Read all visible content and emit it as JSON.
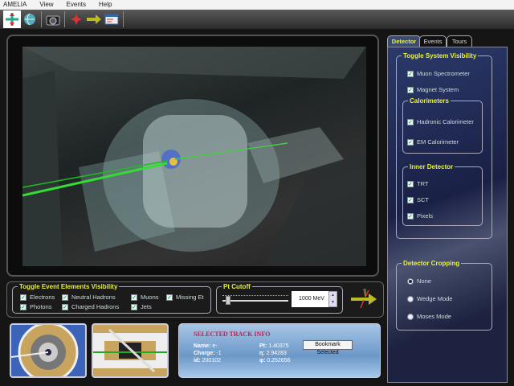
{
  "menu": [
    "AMELIA",
    "View",
    "Events",
    "Help"
  ],
  "toolbar": {
    "icons": [
      "move-icon",
      "globe-icon",
      "camera-icon",
      "star-burst-icon",
      "arrow-icon",
      "window-icon"
    ]
  },
  "events_panel": {
    "title": "Toggle Event Elements Visibility",
    "items": [
      {
        "label": "Electrons",
        "checked": true
      },
      {
        "label": "Neutral Hadrons",
        "checked": true
      },
      {
        "label": "Muons",
        "checked": true
      },
      {
        "label": "Missing Et",
        "checked": true
      },
      {
        "label": "Photons",
        "checked": true
      },
      {
        "label": "Charged Hadrons",
        "checked": true
      },
      {
        "label": "Jets",
        "checked": true
      }
    ]
  },
  "pt_cutoff": {
    "title": "Pt Cutoff",
    "value": "1000 MeV",
    "slider_fraction": 0.05
  },
  "track_info": {
    "title": "SELECTED TRACK INFO",
    "name_label": "Name:",
    "name": "e-",
    "charge_label": "Charge:",
    "charge": "-1",
    "id_label": "id:",
    "id": "200102",
    "pt_label": "Pt:",
    "pt": "1.40375",
    "eta_label": "η:",
    "eta": "2.94283",
    "phi_label": "φ:",
    "phi": "0.252656",
    "bookmark": "Bookmark Selected"
  },
  "tabs": [
    "Detector",
    "Events",
    "Tours"
  ],
  "detector": {
    "system_title": "Toggle System Visibility",
    "muon": "Muon Spectrometer",
    "magnet": "Magnet System",
    "calo_title": "Calorimeters",
    "hadronic": "Hadronic Calorimeter",
    "em": "EM Calorimeter",
    "inner_title": "Inner Detector",
    "trt": "TRT",
    "sct": "SCT",
    "pixels": "Pixels",
    "crop_title": "Detector Cropping",
    "crop_options": [
      "None",
      "Wedge Mode",
      "Moses Mode"
    ],
    "crop_selected": "None"
  }
}
